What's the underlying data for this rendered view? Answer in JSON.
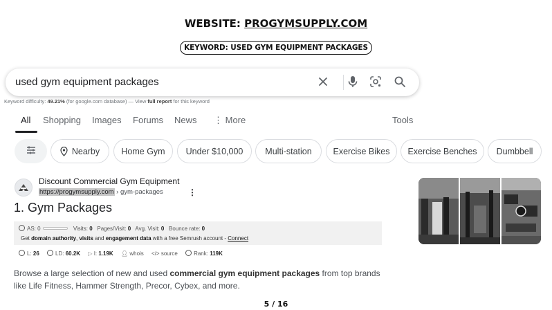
{
  "header": {
    "website_prefix": "WEBSITE: ",
    "website": "PROGYMSUPPLY.COM",
    "keyword": "KEYWORD: USED GYM EQUIPMENT PACKAGES"
  },
  "search": {
    "query": "used gym equipment packages",
    "icons": [
      "clear-icon",
      "microphone-icon",
      "lens-icon",
      "search-icon"
    ]
  },
  "keyword_difficulty": {
    "prefix": "Keyword difficulty: ",
    "value": "49.21%",
    "middle": " (for google.com database) — View ",
    "link": "full report",
    "suffix": " for this keyword"
  },
  "tabs": [
    "All",
    "Shopping",
    "Images",
    "Forums",
    "News",
    "More"
  ],
  "active_tab": "All",
  "tools": "Tools",
  "chips": [
    "Nearby",
    "Home Gym",
    "Under $10,000",
    "Multi-station",
    "Exercise Bikes",
    "Exercise Benches",
    "Dumbbell"
  ],
  "result": {
    "site_name": "Discount Commercial Gym Equipment",
    "url_host": "https://progymsupply.com",
    "url_path": " › gym-packages",
    "title": "1. Gym Packages",
    "semrush": {
      "as_label": "AS: ",
      "as_value": "0",
      "visits_label": "Visits: ",
      "visits": "0",
      "pages_label": "Pages/Visit: ",
      "pages": "0",
      "avg_label": "Avg. Visit: ",
      "avg": "0",
      "bounce_label": "Bounce rate: ",
      "bounce": "0",
      "cta_get": "Get ",
      "cta_b1": "domain authority",
      "cta_sep1": ", ",
      "cta_b2": "visits",
      "cta_and": " and ",
      "cta_b3": "engagement data",
      "cta_rest": " with a free Semrush account - ",
      "cta_link": "Connect"
    },
    "metrics": {
      "l_label": "L: ",
      "l": "26",
      "ld_label": "LD: ",
      "ld": "60.2K",
      "i_label": "I: ",
      "i": "1.19K",
      "whois": "whois",
      "source": "source",
      "rank_label": "Rank: ",
      "rank": "119K"
    },
    "snippet_pre": "Browse a large selection of new and used ",
    "snippet_bold": "commercial gym equipment packages",
    "snippet_post": " from top brands like Life Fitness, Hammer Strength, Precor, Cybex, and more."
  },
  "page_number": "5 / 16"
}
